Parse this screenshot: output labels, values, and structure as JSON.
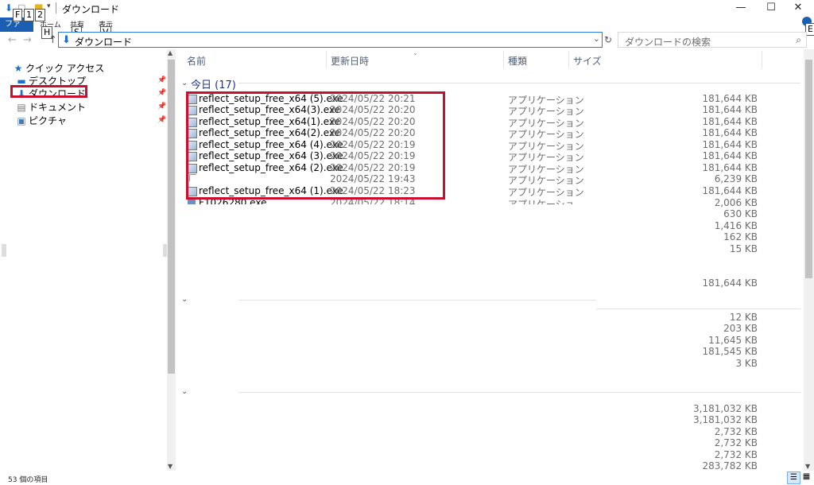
{
  "titlebar": {
    "title": "ダウンロード",
    "minimize_icon": "—",
    "maximize_icon": "☐",
    "close_icon": "✕"
  },
  "ribbon": {
    "file_tab": "ファ",
    "tabs": [
      "ホーム",
      "共有",
      "表示"
    ],
    "keytips": [
      "F",
      "1",
      "2",
      "H",
      "S",
      "V",
      "E"
    ]
  },
  "nav": {
    "back_icon": "←",
    "forward_icon": "→",
    "up_icon": "↑",
    "address": "ダウンロード",
    "search_placeholder": "ダウンロードの検索"
  },
  "sidebar": {
    "items": [
      {
        "label": "クイック アクセス",
        "icon": "star-icon"
      },
      {
        "label": "デスクトップ",
        "icon": "desktop-icon"
      },
      {
        "label": "ダウンロード",
        "icon": "download-icon"
      },
      {
        "label": "ドキュメント",
        "icon": "document-icon"
      },
      {
        "label": "ピクチャ",
        "icon": "pictures-icon"
      }
    ]
  },
  "columns": {
    "name": "名前",
    "date": "更新日時",
    "type": "種類",
    "size": "サイズ"
  },
  "group_today": {
    "label": "今日 (17)"
  },
  "files": [
    {
      "name": "reflect_setup_free_x64 (5).exe",
      "date": "2024/05/22 20:21",
      "type": "アプリケーション",
      "size": "181,644 KB"
    },
    {
      "name": "reflect_setup_free_x64(3).exe",
      "date": "2024/05/22 20:20",
      "type": "アプリケーション",
      "size": "181,644 KB"
    },
    {
      "name": "reflect_setup_free_x64(1).exe",
      "date": "2024/05/22 20:20",
      "type": "アプリケーション",
      "size": "181,644 KB"
    },
    {
      "name": "reflect_setup_free_x64(2).exe",
      "date": "2024/05/22 20:20",
      "type": "アプリケーション",
      "size": "181,644 KB"
    },
    {
      "name": "reflect_setup_free_x64 (4).exe",
      "date": "2024/05/22 20:19",
      "type": "アプリケーション",
      "size": "181,644 KB"
    },
    {
      "name": "reflect_setup_free_x64 (3).exe",
      "date": "2024/05/22 20:19",
      "type": "アプリケーション",
      "size": "181,644 KB"
    },
    {
      "name": "reflect_setup_free_x64 (2).exe",
      "date": "2024/05/22 20:19",
      "type": "アプリケーション",
      "size": "181,644 KB"
    },
    {
      "name": "",
      "date": "2024/05/22 19:43",
      "type": "アプリケーション",
      "size": "6,239 KB"
    },
    {
      "name": "reflect_setup_free_x64 (1).exe",
      "date": "2024/05/22 18:23",
      "type": "アプリケーション",
      "size": "181,644 KB"
    },
    {
      "name": "F1026280.exe",
      "date": "2024/05/22 18:14",
      "type": "アプリケーション",
      "size": "2,006 KB"
    }
  ],
  "extra_sizes_1": [
    "630 KB",
    "1,416 KB",
    "162 KB",
    "15 KB"
  ],
  "extra_size_single": "181,644 KB",
  "extra_sizes_2": [
    "12 KB",
    "203 KB",
    "11,645 KB",
    "181,545 KB",
    "3 KB"
  ],
  "extra_sizes_3": [
    "3,181,032 KB",
    "3,181,032 KB",
    "2,732 KB",
    "2,732 KB",
    "2,732 KB",
    "283,782 KB"
  ],
  "status": {
    "count": "53 個の項目"
  }
}
